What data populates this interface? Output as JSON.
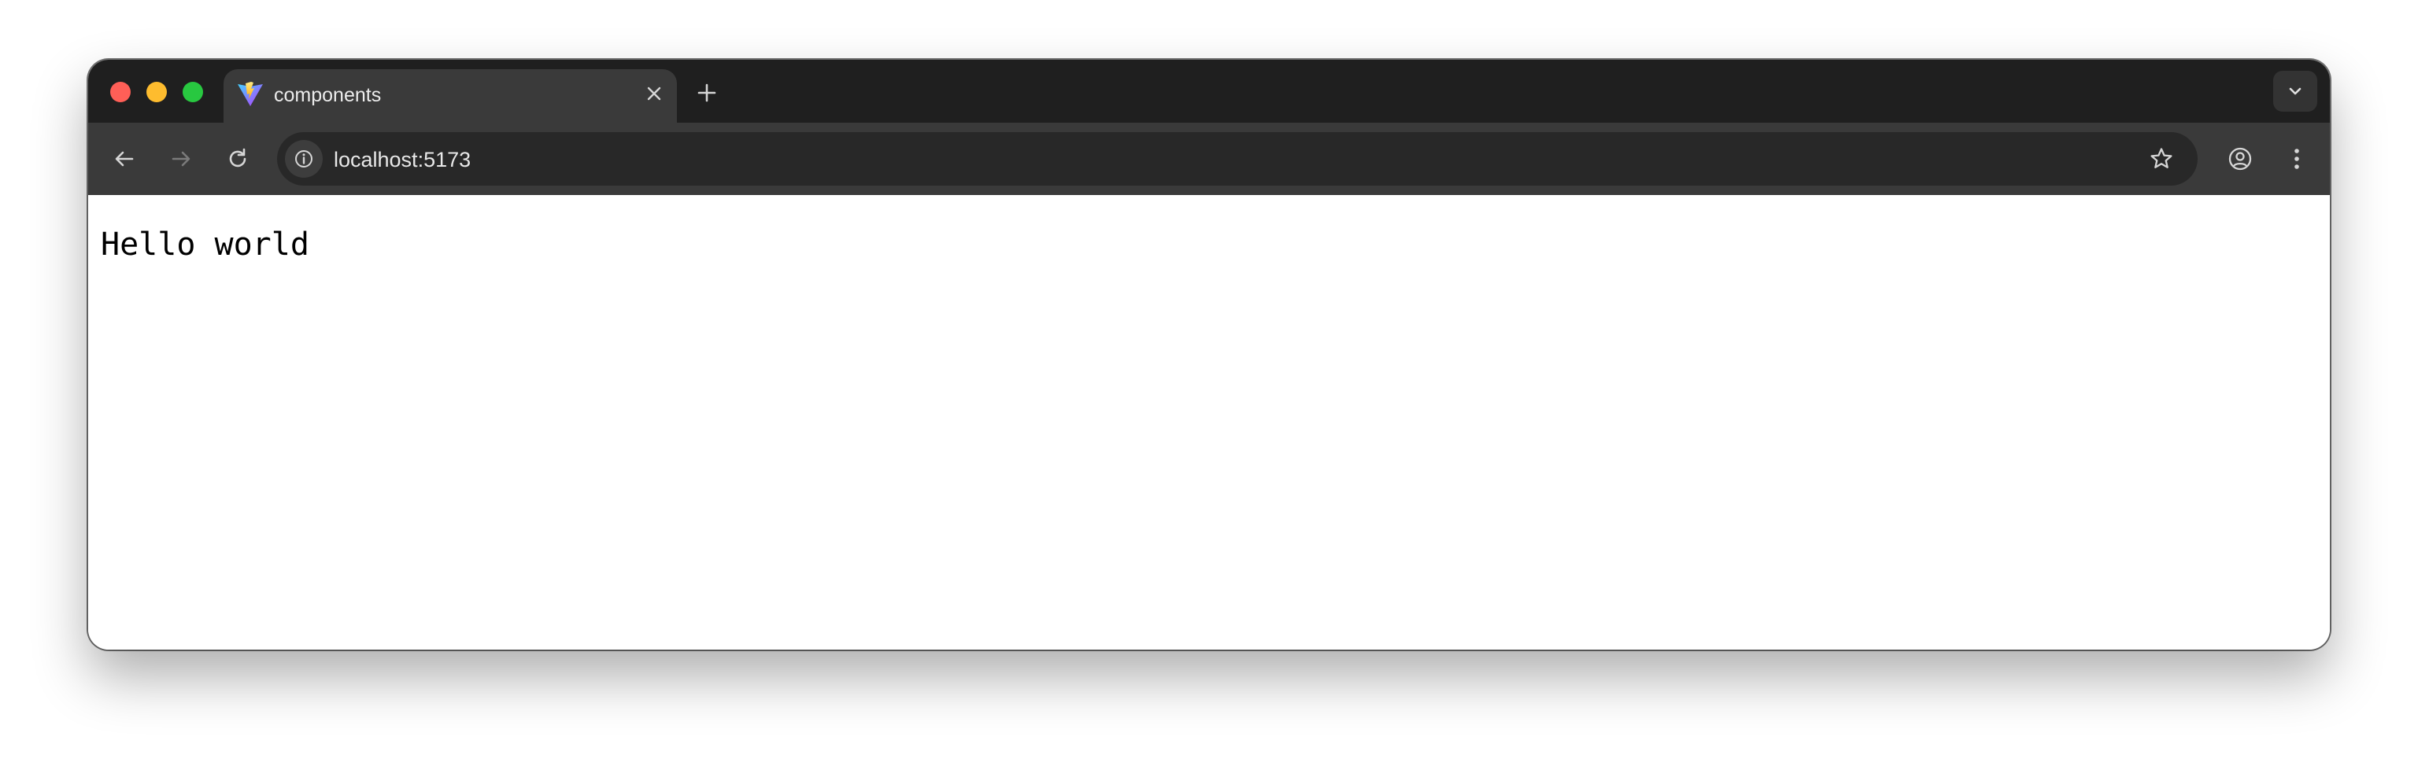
{
  "browser": {
    "tab": {
      "title": "components",
      "favicon": "vite-logo-icon"
    },
    "address_bar": {
      "url": "localhost:5173"
    },
    "icons": {
      "back": "arrow-left-icon",
      "forward": "arrow-right-icon",
      "reload": "reload-icon",
      "site_info": "info-icon",
      "bookmark": "star-icon",
      "profile": "account-circle-icon",
      "menu": "kebab-menu-icon",
      "new_tab": "plus-icon",
      "tab_close": "close-icon",
      "tab_search": "chevron-down-icon"
    },
    "colors": {
      "close": "#ff5f57",
      "minimize": "#febc2e",
      "maximize": "#28c840",
      "tabstrip": "#1f1f1f",
      "toolbar": "#3a3a3a",
      "omnibox": "#282828"
    }
  },
  "page": {
    "text": "Hello world"
  }
}
